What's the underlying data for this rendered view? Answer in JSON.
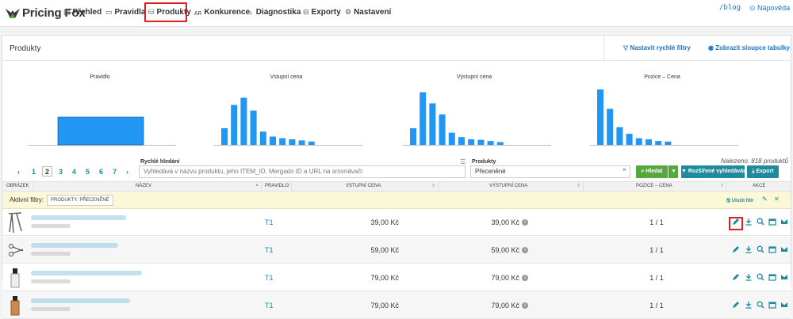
{
  "app": {
    "logo_text": "Pricing Fox"
  },
  "nav": {
    "items": [
      {
        "label": "Přehled",
        "icon": "dashboard-icon"
      },
      {
        "label": "Pravidla",
        "icon": "rules-icon"
      },
      {
        "label": "Produkty",
        "icon": "products-icon",
        "active": true
      },
      {
        "label": "Konkurence",
        "icon": "competition-icon"
      },
      {
        "label": "Diagnostika",
        "icon": "diagnostics-icon"
      },
      {
        "label": "Exporty",
        "icon": "exports-icon"
      },
      {
        "label": "Nastavení",
        "icon": "gear-icon"
      }
    ],
    "blog": "/blog",
    "help": "Nápověda"
  },
  "panel": {
    "title": "Produkty",
    "quick_filters_btn": "Nastavit rychlé filtry",
    "show_columns_btn": "Zobrazit sloupce tabulky"
  },
  "charts": [
    {
      "title": "Pravidlo",
      "values": [
        1.0
      ]
    },
    {
      "title": "Vstupní cena",
      "values": [
        0.3,
        0.72,
        0.85,
        0.62,
        0.24,
        0.15,
        0.12,
        0.1,
        0.08,
        0.06
      ]
    },
    {
      "title": "Výstupní cena",
      "values": [
        0.3,
        0.95,
        0.75,
        0.55,
        0.22,
        0.14,
        0.1,
        0.09,
        0.07,
        0.05
      ]
    },
    {
      "title": "Pozice – Cena",
      "values": [
        1.0,
        0.65,
        0.32,
        0.2,
        0.12,
        0.1,
        0.07,
        0.06
      ]
    }
  ],
  "colors": {
    "accent": "#1f8a9e",
    "bar": "#2196f3",
    "green": "#54a93b",
    "highlight": "#e02020"
  },
  "pagination": {
    "prev": "‹",
    "pages": [
      "1",
      "2",
      "3",
      "4",
      "5",
      "6",
      "7"
    ],
    "current": "2",
    "next": "›"
  },
  "search": {
    "label": "Rychlé hledání",
    "placeholder": "Vyhledává v názvu produktu, jeho ITEM_ID, Mergado ID a URL na srovnávači",
    "products_label": "Produkty",
    "products_value": "Přeceněné",
    "clear": "×",
    "results": "Nalezeno: 818 produktů",
    "search_btn": "Hledat",
    "advanced_btn": "Rozšířené vyhledávání",
    "export_btn": "Export"
  },
  "table": {
    "headers": [
      "OBRÁZEK",
      "NÁZEV",
      "PRAVIDLO",
      "VSTUPNÍ CENA",
      "VÝSTUPNÍ CENA",
      "POZICE – CENA",
      "AKCE"
    ],
    "sort_mark": "▲",
    "active_filters_label": "Aktivní filtry:",
    "active_filter_chip": "PRODUKTY: PŘECENĚNÉ",
    "save_filter": "Uložit filtr",
    "rows": [
      {
        "rule": "T1",
        "price_in": "39,00 Kč",
        "price_out": "39,00 Kč",
        "position": "1 / 1"
      },
      {
        "rule": "T1",
        "price_in": "59,00 Kč",
        "price_out": "59,00 Kč",
        "position": "1 / 1"
      },
      {
        "rule": "T1",
        "price_in": "79,00 Kč",
        "price_out": "79,00 Kč",
        "position": "1 / 1"
      },
      {
        "rule": "T1",
        "price_in": "79,00 Kč",
        "price_out": "79,00 Kč",
        "position": "1 / 1"
      }
    ],
    "info_glyph": "i"
  }
}
